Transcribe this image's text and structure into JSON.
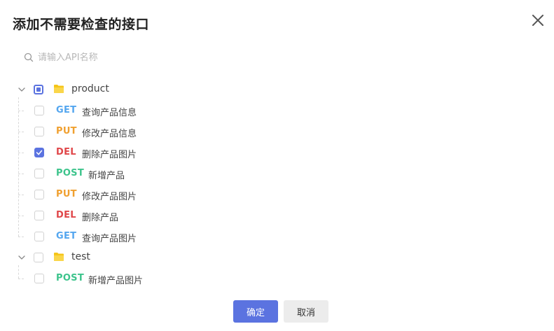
{
  "dialog": {
    "title": "添加不需要检查的接口",
    "search_placeholder": "请输入API名称",
    "search_value": "",
    "ok_label": "确定",
    "cancel_label": "取消"
  },
  "tree": {
    "groups": [
      {
        "name": "product",
        "state": "indeterminate",
        "expanded": true,
        "items": [
          {
            "method": "GET",
            "name": "查询产品信息",
            "checked": false
          },
          {
            "method": "PUT",
            "name": "修改产品信息",
            "checked": false
          },
          {
            "method": "DEL",
            "name": "删除产品图片",
            "checked": true
          },
          {
            "method": "POST",
            "name": "新增产品",
            "checked": false
          },
          {
            "method": "PUT",
            "name": "修改产品图片",
            "checked": false
          },
          {
            "method": "DEL",
            "name": "删除产品",
            "checked": false
          },
          {
            "method": "GET",
            "name": "查询产品图片",
            "checked": false
          }
        ]
      },
      {
        "name": "test",
        "state": "unchecked",
        "expanded": true,
        "items": [
          {
            "method": "POST",
            "name": "新增产品图片",
            "checked": false
          }
        ]
      }
    ]
  },
  "colors": {
    "primary": "#5b73e0",
    "get": "#54a6ef",
    "put": "#f0a030",
    "del": "#e0474a",
    "post": "#3dc48c",
    "folder": "#f5c518"
  }
}
